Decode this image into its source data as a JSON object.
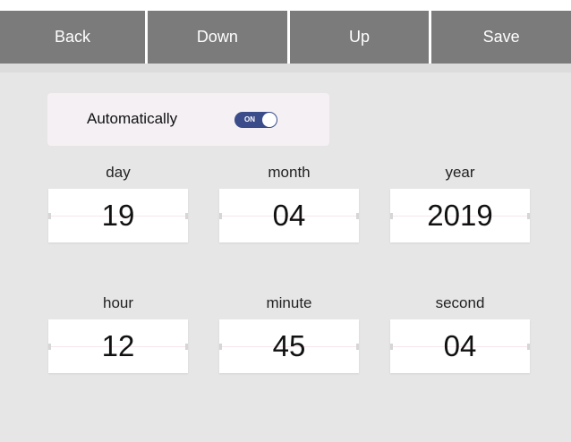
{
  "toolbar": {
    "back_label": "Back",
    "down_label": "Down",
    "up_label": "Up",
    "save_label": "Save"
  },
  "auto": {
    "label": "Automatically",
    "toggle_text": "ON",
    "toggle_on": true
  },
  "date": {
    "day_label": "day",
    "day_value": "19",
    "month_label": "month",
    "month_value": "04",
    "year_label": "year",
    "year_value": "2019"
  },
  "time": {
    "hour_label": "hour",
    "hour_value": "12",
    "minute_label": "minute",
    "minute_value": "45",
    "second_label": "second",
    "second_value": "04"
  },
  "colors": {
    "toolbar_button": "#7a7b7a",
    "background": "#e6e6e6",
    "toggle_on": "#3a4c8a"
  }
}
